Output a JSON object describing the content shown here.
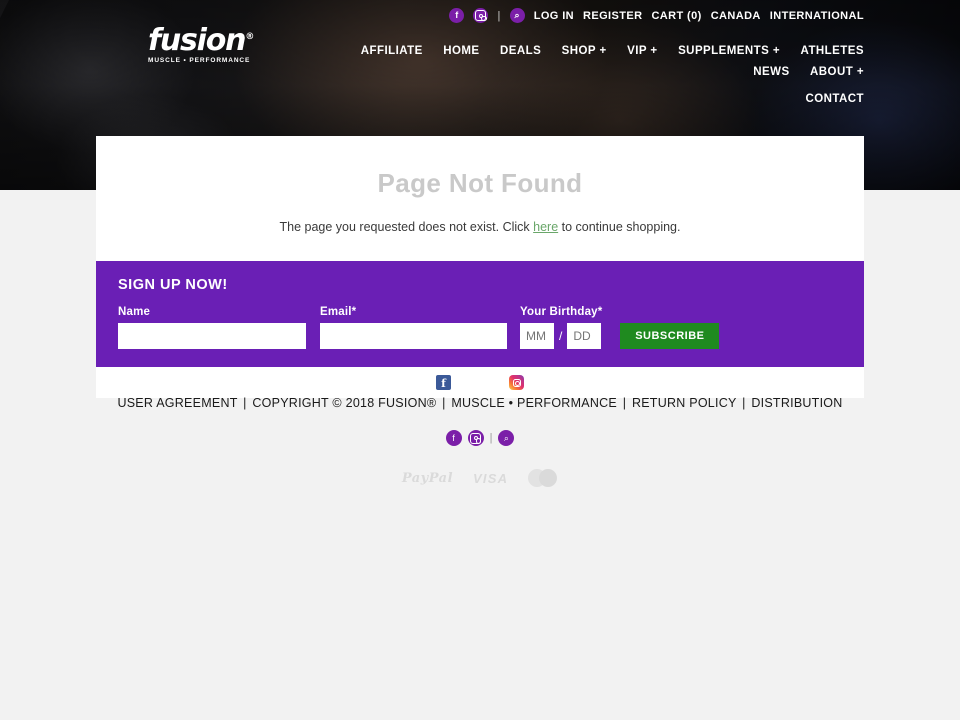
{
  "brand": {
    "logo_word": "fusion",
    "logo_reg": "®",
    "logo_tagline": "MUSCLE • PERFORMANCE"
  },
  "topbar": {
    "facebook_icon": "f",
    "instagram_icon": "instagram-icon",
    "search_icon": "⌕",
    "divider": "|",
    "login": "LOG IN",
    "register": "REGISTER",
    "cart": "CART (0)",
    "lang_canada": "CANADA",
    "lang_international": "INTERNATIONAL"
  },
  "nav": {
    "row1": [
      {
        "label": "AFFILIATE"
      },
      {
        "label": "HOME"
      },
      {
        "label": "DEALS"
      },
      {
        "label": "SHOP +"
      },
      {
        "label": "VIP +"
      },
      {
        "label": "SUPPLEMENTS +"
      },
      {
        "label": "ATHLETES"
      },
      {
        "label": "NEWS"
      },
      {
        "label": "ABOUT +"
      }
    ],
    "row2": [
      {
        "label": "CONTACT"
      }
    ]
  },
  "main": {
    "title": "Page Not Found",
    "message_before": "The page you requested does not exist. Click ",
    "message_link": "here",
    "message_after": " to continue shopping."
  },
  "signup": {
    "title": "SIGN UP NOW!",
    "name_label": "Name",
    "name_value": "",
    "name_placeholder": "",
    "email_label": "Email*",
    "email_value": "",
    "email_placeholder": "",
    "birthday_label": "Your Birthday*",
    "birthday_mm_placeholder": "MM",
    "birthday_mm_value": "",
    "birthday_separator": "/",
    "birthday_dd_placeholder": "DD",
    "birthday_dd_value": "",
    "subscribe_label": "SUBSCRIBE"
  },
  "card_social": {
    "facebook_icon": "f",
    "instagram_icon": "instagram-icon"
  },
  "footer": {
    "links": [
      {
        "label": "USER AGREEMENT"
      },
      {
        "label": "COPYRIGHT © 2018 FUSION®"
      },
      {
        "label": "MUSCLE • PERFORMANCE"
      },
      {
        "label": "RETURN POLICY"
      },
      {
        "label": "DISTRIBUTION"
      }
    ],
    "separator": "|",
    "social": {
      "facebook_icon": "f",
      "instagram_icon": "instagram-icon",
      "divider": "|",
      "search_icon": "⌕"
    },
    "payments": [
      {
        "name": "PayPal"
      },
      {
        "name": "VISA"
      },
      {
        "name": "Mastercard"
      }
    ]
  },
  "colors": {
    "purple": "#6a1fb5",
    "green": "#1f8a1f",
    "link_green": "#6aa76a",
    "icon_purple": "#7b1fa8",
    "facebook_blue": "#3b5998",
    "title_gray": "#c9c9c9",
    "page_bg": "#f2f2f2"
  }
}
